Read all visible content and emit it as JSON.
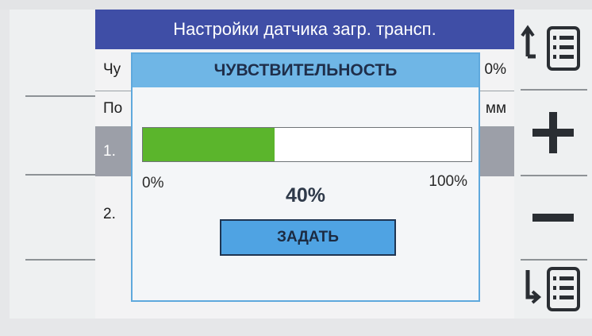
{
  "screen": {
    "title": "Настройки датчика загр. трансп.",
    "rows": [
      {
        "left": "Чу",
        "right": "0%"
      },
      {
        "left": "По",
        "right": "мм"
      },
      {
        "left": "1.",
        "right": ""
      },
      {
        "left": "2.",
        "right": ""
      }
    ]
  },
  "dialog": {
    "title": "ЧУВСТВИТЕЛЬНОСТЬ",
    "progress_fraction": 0.4,
    "min_label": "0%",
    "max_label": "100%",
    "value_label": "40%",
    "set_button_label": "ЗАДАТЬ"
  },
  "softkeys": {
    "right": [
      {
        "icon": "list-up-icon"
      },
      {
        "icon": "plus-icon"
      },
      {
        "icon": "minus-icon"
      },
      {
        "icon": "list-down-icon"
      }
    ]
  },
  "colors": {
    "title_bar": "#3f4ea6",
    "dialog_header": "#6fb6e6",
    "progress_fill": "#5bb52c",
    "set_button": "#4fa3e3",
    "selected_row": "#9c9fa8"
  }
}
